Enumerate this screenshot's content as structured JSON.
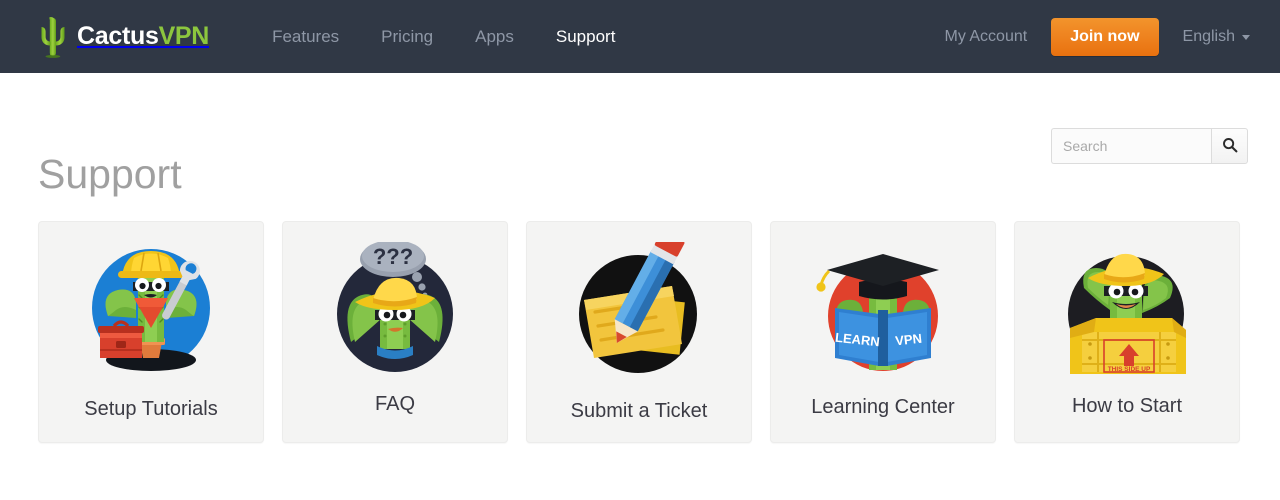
{
  "header": {
    "logo": {
      "icon": "cactus-logo-icon",
      "text_primary": "Cactus",
      "text_accent": "VPN",
      "accent_color": "#8cc63e",
      "bar_color": "#303845"
    },
    "nav": [
      {
        "label": "Features",
        "active": false
      },
      {
        "label": "Pricing",
        "active": false
      },
      {
        "label": "Apps",
        "active": false
      },
      {
        "label": "Support",
        "active": true
      }
    ],
    "my_account_label": "My Account",
    "join_label": "Join now",
    "join_color": "#ef8420",
    "language_label": "English",
    "caret_icon": "chevron-down-icon"
  },
  "page": {
    "title": "Support",
    "title_color": "#a0a0a0"
  },
  "search": {
    "placeholder": "Search",
    "value": "",
    "button_icon": "search-icon"
  },
  "cards": [
    {
      "label": "Setup Tutorials",
      "art": "cactus-engineer-illustration",
      "circle_color": "#1b7fd4"
    },
    {
      "label": "FAQ",
      "art": "cactus-thinking-illustration",
      "circle_color": "#23283a"
    },
    {
      "label": "Submit a Ticket",
      "art": "envelope-pencil-illustration",
      "circle_color": "#111111"
    },
    {
      "label": "Learning Center",
      "art": "cactus-graduate-illustration",
      "circle_color": "#e0412c"
    },
    {
      "label": "How to Start",
      "art": "cactus-crate-illustration",
      "circle_color": "#1d1d22"
    }
  ]
}
